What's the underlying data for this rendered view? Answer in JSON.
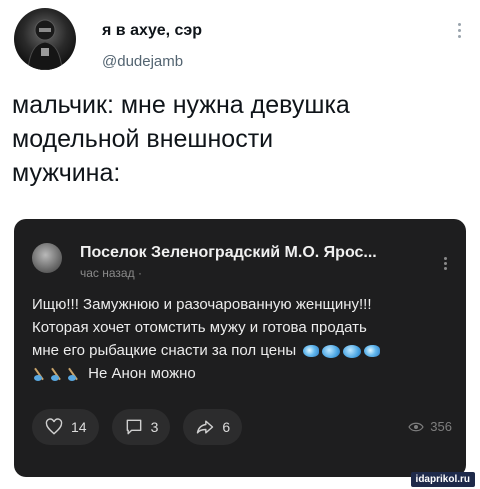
{
  "tweet": {
    "author": {
      "display_name": "я в ахуе, сэр",
      "handle": "@dudejamb"
    },
    "text": "мальчик: мне нужна девушка\nмодельной внешности\nмужчина:"
  },
  "embedded_post": {
    "group_name": "Поселок Зеленоградский М.О. Ярос...",
    "time": "час назад ·",
    "line1": "Ищю!!! Замужнюю и разочарованную женщину!!!",
    "line2": "Которая хочет отомстить мужу и готова продать",
    "line3": "мне его рыбацкие снасти за пол цены",
    "line4": "Не Анон можно",
    "likes": "14",
    "comments": "3",
    "shares": "6",
    "views": "356"
  },
  "watermark": "idaprikol.ru",
  "icons": [
    "more-vertical-icon",
    "heart-icon",
    "comment-icon",
    "share-icon",
    "eye-icon",
    "fish-emoji",
    "whale-emoji",
    "fishing-rod-emoji"
  ],
  "colors": {
    "card_bg": "#1e1e1f",
    "pill_bg": "#2c2c2d",
    "text_dark": "#0f1419",
    "handle_gray": "#536471"
  }
}
